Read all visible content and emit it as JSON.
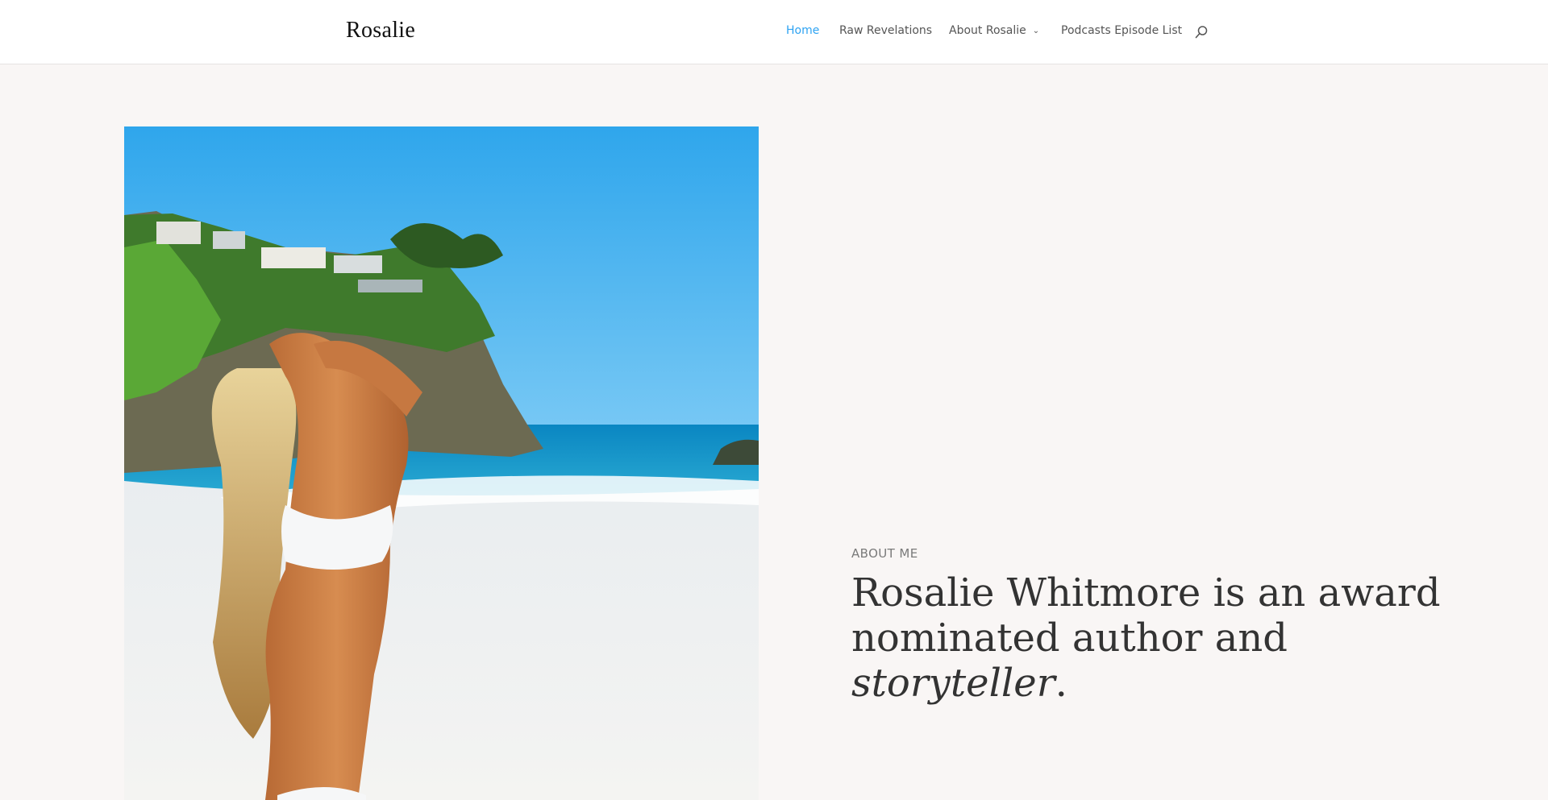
{
  "header": {
    "logo": "Rosalie",
    "nav": [
      {
        "label": "Home",
        "active": true
      },
      {
        "label": "Raw Revelations",
        "active": false
      },
      {
        "label": "About Rosalie",
        "active": false,
        "has_dropdown": true
      },
      {
        "label": "Podcasts Episode List",
        "active": false
      }
    ],
    "search_icon": "search-icon"
  },
  "hero": {
    "image_subject": "woman in white bikini on beach with cliffs and ocean",
    "eyebrow": "ABOUT ME",
    "headline_line1": "Rosalie Whitmore is an award",
    "headline_line2": "nominated author and",
    "headline_italic": "storyteller",
    "headline_end": "."
  },
  "colors": {
    "accent": "#2ea3f2",
    "page_bg": "#f9f6f5",
    "header_bg": "#ffffff",
    "text_dark": "#333333",
    "nav_text": "#555555"
  }
}
